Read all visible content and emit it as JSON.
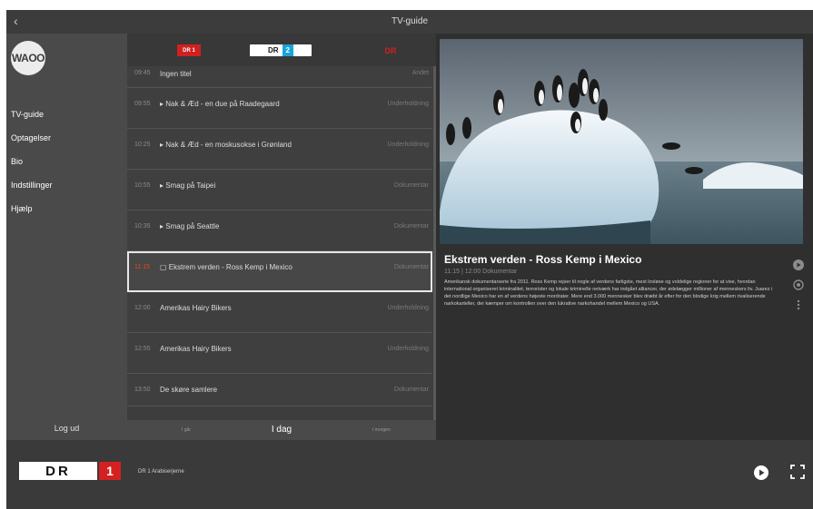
{
  "window": {
    "back_icon": "chevron-left-icon",
    "title": "TV-guide"
  },
  "sidebar": {
    "logo": "WAOO",
    "items": [
      {
        "label": "TV-guide"
      },
      {
        "label": "Optagelser"
      },
      {
        "label": "Bio"
      },
      {
        "label": "Indstillinger"
      },
      {
        "label": "Hjælp"
      }
    ],
    "logout": "Log ud"
  },
  "guide": {
    "channels": {
      "left": "DR 1",
      "center": "DR",
      "center_num": "2",
      "right": "DR"
    },
    "rows": [
      {
        "time": "09:45",
        "title": "Ingen titel",
        "genre": "Andet"
      },
      {
        "time": "09:55",
        "title": "▸ Nak & Æd - en due på Raadegaard",
        "genre": "Underholdning"
      },
      {
        "time": "10:25",
        "title": "▸ Nak & Æd - en moskusokse i Grønland",
        "genre": "Underholdning"
      },
      {
        "time": "10:55",
        "title": "▸ Smag på Taipei",
        "genre": "Dokumentar"
      },
      {
        "time": "10:35",
        "title": "▸ Smag på Seattle",
        "genre": "Dokumentar"
      },
      {
        "time": "11:15",
        "title": "▢ Ekstrem verden - Ross Kemp i Mexico",
        "genre": "Dokumentar"
      },
      {
        "time": "12:00",
        "title": "Amerikas Hairy Bikers",
        "genre": "Underholdning"
      },
      {
        "time": "12:55",
        "title": "Amerikas Hairy Bikers",
        "genre": "Underholdning"
      },
      {
        "time": "13:50",
        "title": "De skøre samlere",
        "genre": "Dokumentar"
      }
    ],
    "day": {
      "prev": "I går",
      "today": "I dag",
      "next": "I morgen"
    }
  },
  "detail": {
    "title": "Ekstrem verden - Ross Kemp i Mexico",
    "meta": "11:15 | 12:00  Dokumentar",
    "description": "Amerikansk dokumentarserie fra 2011. Ross Kemp rejser til nogle af verdens farligste, mest lovløse og voldelige regioner for at vise, hvordan international organiseret kriminalitet, terrorister og lokale kriminelle netværk har indgået alliancer, der ødelægger millioner af menneskers liv. Juarez i det nordlige Mexico har en af verdens højeste mordrater. Mere end 3.000 mennesker blev dræbt år efter for den blodige krig mellem rivaliserende narkokarteller, der kæmper om kontrollen over den lukrative narkohandel mellem Mexico og USA.",
    "actions": [
      "play-icon",
      "record-icon",
      "more-vertical-icon"
    ]
  },
  "player": {
    "channel": "DR",
    "channel_num": "1",
    "now": "DR 1 Arabiserjerne",
    "play_icon": "play-icon",
    "fullscreen_icon": "fullscreen-icon"
  }
}
